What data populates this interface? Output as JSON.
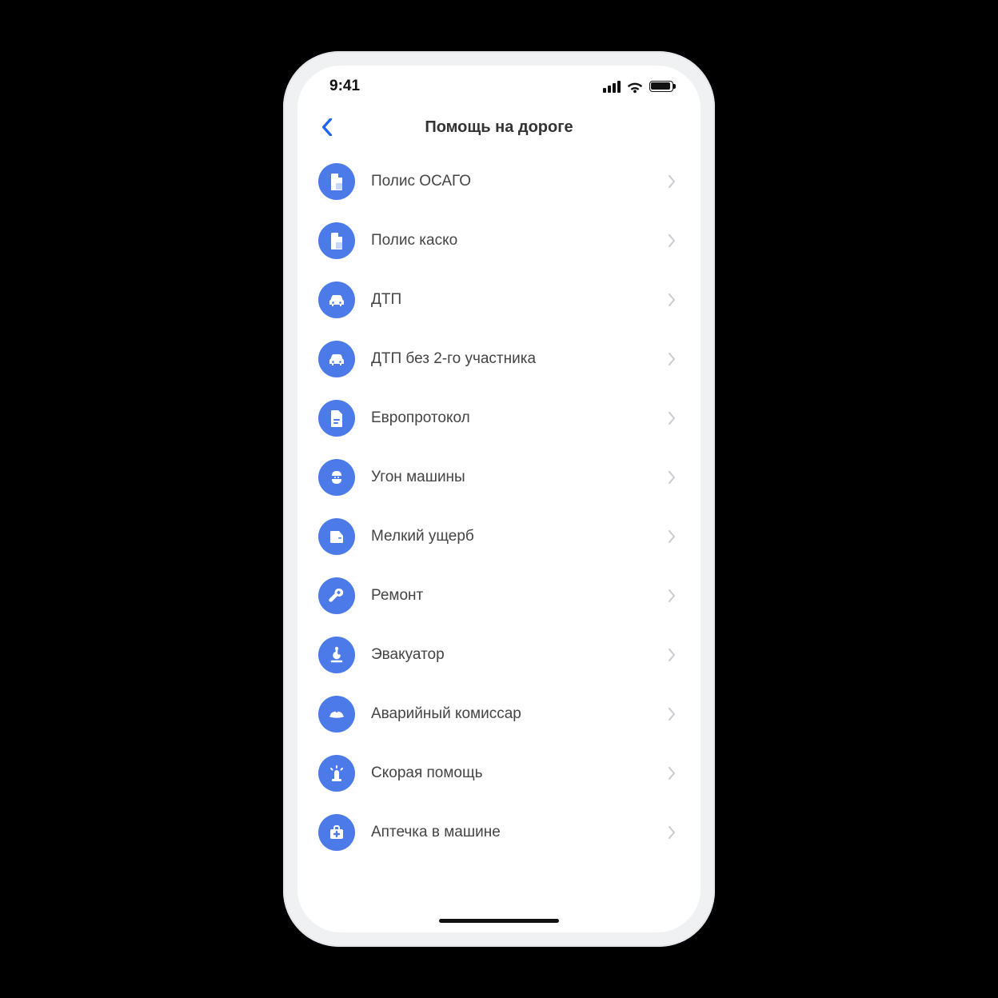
{
  "status": {
    "time": "9:41"
  },
  "header": {
    "title": "Помощь на дороге"
  },
  "accent_color": "#4C7AE8",
  "items": [
    {
      "label": "Полис ОСАГО",
      "icon": "document-icon"
    },
    {
      "label": "Полис каско",
      "icon": "document-icon"
    },
    {
      "label": "ДТП",
      "icon": "cars-icon"
    },
    {
      "label": "ДТП без 2-го участника",
      "icon": "cars-icon"
    },
    {
      "label": "Европротокол",
      "icon": "form-icon"
    },
    {
      "label": "Угон машины",
      "icon": "thief-icon"
    },
    {
      "label": "Мелкий ущерб",
      "icon": "door-icon"
    },
    {
      "label": "Ремонт",
      "icon": "wrench-icon"
    },
    {
      "label": "Эвакуатор",
      "icon": "hook-icon"
    },
    {
      "label": "Аварийный комиссар",
      "icon": "cap-icon"
    },
    {
      "label": "Скорая помощь",
      "icon": "beacon-icon"
    },
    {
      "label": "Аптечка в машине",
      "icon": "kit-icon"
    }
  ]
}
